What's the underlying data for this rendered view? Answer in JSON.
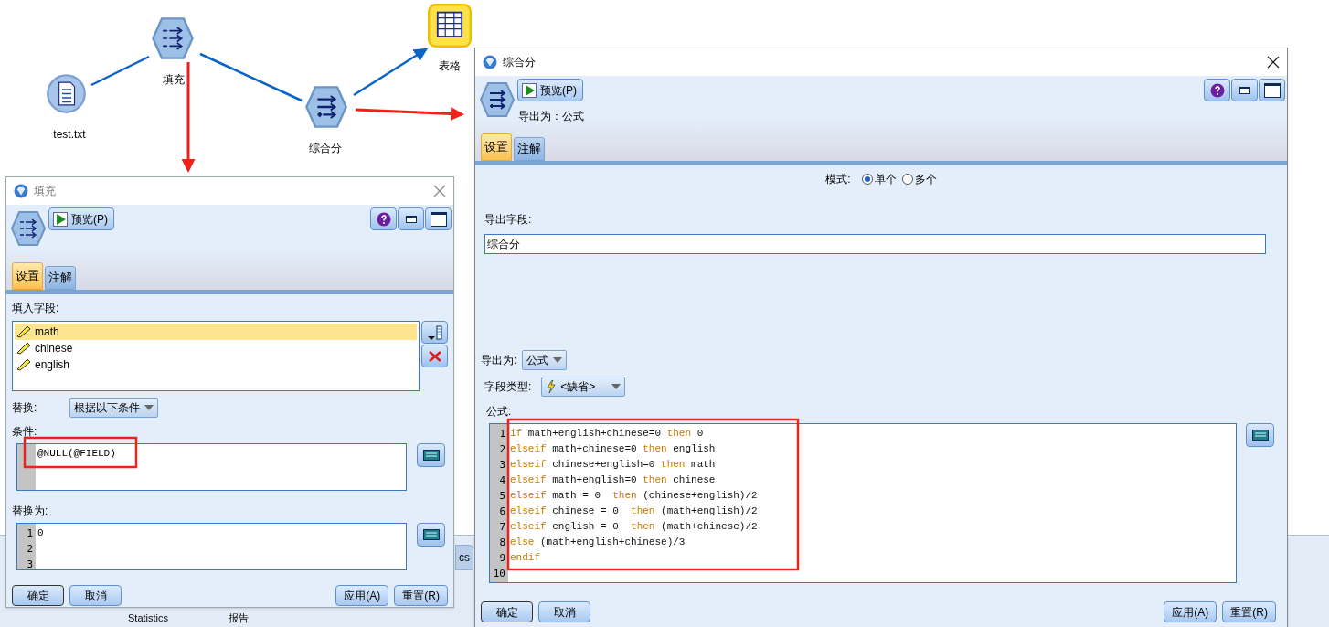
{
  "canvas": {
    "nodes": [
      {
        "kind": "file",
        "label": "test.txt"
      },
      {
        "kind": "filler",
        "label": "填充"
      },
      {
        "kind": "derive",
        "label": "综合分"
      },
      {
        "kind": "table",
        "label": "表格"
      }
    ],
    "palette_tab": "cs",
    "palette_items": [
      "Statistics",
      "报告"
    ]
  },
  "fill_dialog": {
    "title": "填充",
    "preview_button": "预览(P)",
    "tabs": [
      {
        "label": "设置",
        "selected": true
      },
      {
        "label": "注解",
        "selected": false
      }
    ],
    "fields_label": "填入字段:",
    "fields": [
      {
        "name": "math",
        "selected": true
      },
      {
        "name": "chinese",
        "selected": false
      },
      {
        "name": "english",
        "selected": false
      }
    ],
    "replace_label": "替换:",
    "replace_value": "根据以下条件",
    "condition_label": "条件:",
    "condition": "@NULL(@FIELD)",
    "replace_with_label": "替换为:",
    "replace_with_lines": [
      "1",
      "2",
      "3"
    ],
    "replace_with": "0",
    "buttons": [
      "确定",
      "取消",
      "应用(A)",
      "重置(R)"
    ]
  },
  "derive_dialog": {
    "title": "综合分",
    "preview_button": "预览(P)",
    "derive_as_summary": "导出为：公式",
    "tabs": [
      {
        "label": "设置",
        "selected": true
      },
      {
        "label": "注解",
        "selected": false
      }
    ],
    "mode_label": "模式:",
    "modes": [
      {
        "label": "单个",
        "selected": true
      },
      {
        "label": "多个",
        "selected": false
      }
    ],
    "field_label": "导出字段:",
    "field_value": "综合分",
    "derive_as_label": "导出为:",
    "derive_as_value": "公式",
    "field_type_label": "字段类型:",
    "field_type_value": "<缺省>",
    "formula_label": "公式:",
    "formula": [
      [
        {
          "kind": "keyword",
          "text": "if"
        },
        {
          "kind": "code",
          "text": " math+english+chinese=0 "
        },
        {
          "kind": "keyword",
          "text": "then"
        },
        {
          "kind": "code",
          "text": " 0"
        }
      ],
      [
        {
          "kind": "keyword",
          "text": "elseif"
        },
        {
          "kind": "code",
          "text": " math+chinese=0 "
        },
        {
          "kind": "keyword",
          "text": "then"
        },
        {
          "kind": "code",
          "text": " english"
        }
      ],
      [
        {
          "kind": "keyword",
          "text": "elseif"
        },
        {
          "kind": "code",
          "text": " chinese+english=0 "
        },
        {
          "kind": "keyword",
          "text": "then"
        },
        {
          "kind": "code",
          "text": " math"
        }
      ],
      [
        {
          "kind": "keyword",
          "text": "elseif"
        },
        {
          "kind": "code",
          "text": " math+english=0 "
        },
        {
          "kind": "keyword",
          "text": "then"
        },
        {
          "kind": "code",
          "text": " chinese"
        }
      ],
      [
        {
          "kind": "keyword",
          "text": "elseif"
        },
        {
          "kind": "code",
          "text": " math = 0  "
        },
        {
          "kind": "keyword",
          "text": "then"
        },
        {
          "kind": "code",
          "text": " (chinese+english)/2"
        }
      ],
      [
        {
          "kind": "keyword",
          "text": "elseif"
        },
        {
          "kind": "code",
          "text": " chinese = 0  "
        },
        {
          "kind": "keyword",
          "text": "then"
        },
        {
          "kind": "code",
          "text": " (math+english)/2"
        }
      ],
      [
        {
          "kind": "keyword",
          "text": "elseif"
        },
        {
          "kind": "code",
          "text": " english = 0  "
        },
        {
          "kind": "keyword",
          "text": "then"
        },
        {
          "kind": "code",
          "text": " (math+chinese)/2"
        }
      ],
      [
        {
          "kind": "keyword",
          "text": "else"
        },
        {
          "kind": "code",
          "text": " (math+english+chinese)/3"
        }
      ],
      [
        {
          "kind": "keyword",
          "text": "endif"
        }
      ]
    ],
    "line_numbers": [
      "1",
      "2",
      "3",
      "4",
      "5",
      "6",
      "7",
      "8",
      "9",
      "10"
    ],
    "buttons": [
      "确定",
      "取消",
      "应用(A)",
      "重置(R)"
    ]
  }
}
